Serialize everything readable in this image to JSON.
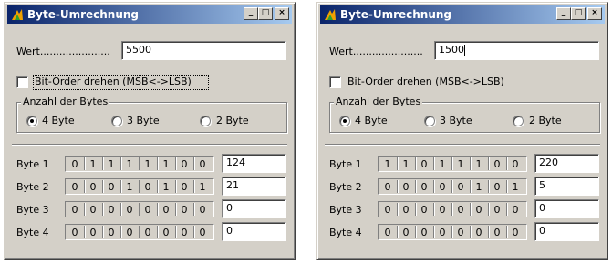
{
  "windows": [
    {
      "title": "Byte-Umrechnung",
      "wert_label": "Wert......................",
      "wert_value": "5500",
      "checkbox_label": "Bit-Order drehen (MSB<->LSB)",
      "checkbox_checked": false,
      "group_label": "Anzahl der Bytes",
      "radios": [
        {
          "label": "4 Byte",
          "selected": true
        },
        {
          "label": "3 Byte",
          "selected": false
        },
        {
          "label": "2 Byte",
          "selected": false
        }
      ],
      "bytes": [
        {
          "label": "Byte 1",
          "bits": [
            "0",
            "1",
            "1",
            "1",
            "1",
            "1",
            "0",
            "0"
          ],
          "value": "124"
        },
        {
          "label": "Byte 2",
          "bits": [
            "0",
            "0",
            "0",
            "1",
            "0",
            "1",
            "0",
            "1"
          ],
          "value": "21"
        },
        {
          "label": "Byte 3",
          "bits": [
            "0",
            "0",
            "0",
            "0",
            "0",
            "0",
            "0",
            "0"
          ],
          "value": "0"
        },
        {
          "label": "Byte 4",
          "bits": [
            "0",
            "0",
            "0",
            "0",
            "0",
            "0",
            "0",
            "0"
          ],
          "value": "0"
        }
      ]
    },
    {
      "title": "Byte-Umrechnung",
      "wert_label": "Wert......................",
      "wert_value": "1500",
      "checkbox_label": "Bit-Order drehen (MSB<->LSB)",
      "checkbox_checked": false,
      "group_label": "Anzahl der Bytes",
      "radios": [
        {
          "label": "4 Byte",
          "selected": true
        },
        {
          "label": "3 Byte",
          "selected": false
        },
        {
          "label": "2 Byte",
          "selected": false
        }
      ],
      "bytes": [
        {
          "label": "Byte 1",
          "bits": [
            "1",
            "1",
            "0",
            "1",
            "1",
            "1",
            "0",
            "0"
          ],
          "value": "220"
        },
        {
          "label": "Byte 2",
          "bits": [
            "0",
            "0",
            "0",
            "0",
            "0",
            "1",
            "0",
            "1"
          ],
          "value": "5"
        },
        {
          "label": "Byte 3",
          "bits": [
            "0",
            "0",
            "0",
            "0",
            "0",
            "0",
            "0",
            "0"
          ],
          "value": "0"
        },
        {
          "label": "Byte 4",
          "bits": [
            "0",
            "0",
            "0",
            "0",
            "0",
            "0",
            "0",
            "0"
          ],
          "value": "0"
        }
      ]
    }
  ],
  "title_buttons": {
    "minimize": "_",
    "maximize": "□",
    "close": "×"
  },
  "icons": {
    "app": "app-icon",
    "minimize": "minimize-icon",
    "maximize": "maximize-icon",
    "close": "close-icon"
  },
  "colors": {
    "titlebar_start": "#0a246a",
    "titlebar_end": "#a6caf0",
    "face": "#d4d0c8"
  }
}
